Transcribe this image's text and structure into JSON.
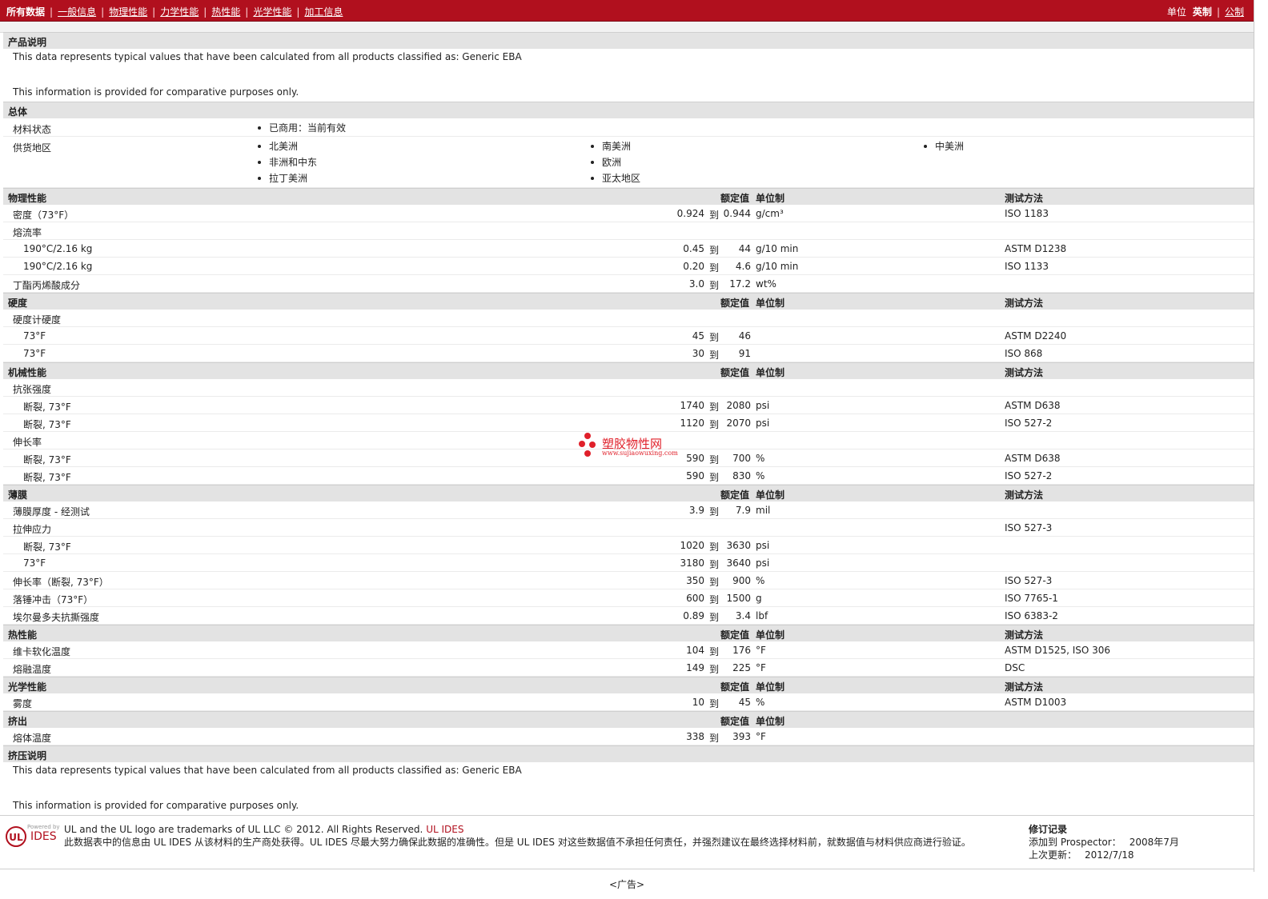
{
  "nav": {
    "tabs": [
      "所有数据",
      "一般信息",
      "物理性能",
      "力学性能",
      "热性能",
      "光学性能",
      "加工信息"
    ],
    "units_label": "单位",
    "unit_selected": "英制",
    "unit_alt": "公制"
  },
  "header_labels": {
    "nominal": "额定值",
    "unit": "单位制",
    "test": "测试方法"
  },
  "product": {
    "title": "产品说明",
    "line1": "This data represents typical values that have been calculated from all products classified as: Generic EBA",
    "line2": "This information is provided for comparative purposes only."
  },
  "general": {
    "title": "总体",
    "status_label": "材料状态",
    "status_value": "已商用：当前有效",
    "supply_label": "供货地区",
    "regions_col1": [
      "北美洲",
      "非洲和中东",
      "拉丁美洲"
    ],
    "regions_col2": [
      "南美洲",
      "欧洲",
      "亚太地区"
    ],
    "regions_col3": [
      "中美洲"
    ]
  },
  "physical": {
    "title": "物理性能",
    "rows": [
      {
        "label": "密度（73°F）",
        "v1": "0.924",
        "to": "到",
        "v2": "0.944",
        "unit": "g/cm³",
        "test": "ISO 1183",
        "sub": false
      },
      {
        "label": "熔流率",
        "v1": "",
        "to": "",
        "v2": "",
        "unit": "",
        "test": "",
        "sub": false
      },
      {
        "label": "190°C/2.16 kg",
        "v1": "0.45",
        "to": "到",
        "v2": "44",
        "unit": "g/10 min",
        "test": "ASTM D1238",
        "sub": true
      },
      {
        "label": "190°C/2.16 kg",
        "v1": "0.20",
        "to": "到",
        "v2": "4.6",
        "unit": "g/10 min",
        "test": "ISO 1133",
        "sub": true
      },
      {
        "label": "丁酯丙烯酸成分",
        "v1": "3.0",
        "to": "到",
        "v2": "17.2",
        "unit": "wt%",
        "test": "",
        "sub": false
      }
    ]
  },
  "hardness": {
    "title": "硬度",
    "rows": [
      {
        "label": "硬度计硬度",
        "v1": "",
        "to": "",
        "v2": "",
        "unit": "",
        "test": "",
        "sub": false
      },
      {
        "label": "73°F",
        "v1": "45",
        "to": "到",
        "v2": "46",
        "unit": "",
        "test": "ASTM D2240",
        "sub": true
      },
      {
        "label": "73°F",
        "v1": "30",
        "to": "到",
        "v2": "91",
        "unit": "",
        "test": "ISO 868",
        "sub": true
      }
    ]
  },
  "mechanical": {
    "title": "机械性能",
    "rows": [
      {
        "label": "抗张强度",
        "v1": "",
        "to": "",
        "v2": "",
        "unit": "",
        "test": "",
        "sub": false
      },
      {
        "label": "断裂, 73°F",
        "v1": "1740",
        "to": "到",
        "v2": "2080",
        "unit": "psi",
        "test": "ASTM D638",
        "sub": true
      },
      {
        "label": "断裂, 73°F",
        "v1": "1120",
        "to": "到",
        "v2": "2070",
        "unit": "psi",
        "test": "ISO 527-2",
        "sub": true
      },
      {
        "label": "伸长率",
        "v1": "",
        "to": "",
        "v2": "",
        "unit": "",
        "test": "",
        "sub": false
      },
      {
        "label": "断裂, 73°F",
        "v1": "590",
        "to": "到",
        "v2": "700",
        "unit": "%",
        "test": "ASTM D638",
        "sub": true
      },
      {
        "label": "断裂, 73°F",
        "v1": "590",
        "to": "到",
        "v2": "830",
        "unit": "%",
        "test": "ISO 527-2",
        "sub": true
      }
    ]
  },
  "film": {
    "title": "薄膜",
    "rows": [
      {
        "label": "薄膜厚度 - 经测试",
        "v1": "3.9",
        "to": "到",
        "v2": "7.9",
        "unit": "mil",
        "test": "",
        "sub": false
      },
      {
        "label": "拉伸应力",
        "v1": "",
        "to": "",
        "v2": "",
        "unit": "",
        "test": "ISO 527-3",
        "sub": false
      },
      {
        "label": "断裂, 73°F",
        "v1": "1020",
        "to": "到",
        "v2": "3630",
        "unit": "psi",
        "test": "",
        "sub": true
      },
      {
        "label": "73°F",
        "v1": "3180",
        "to": "到",
        "v2": "3640",
        "unit": "psi",
        "test": "",
        "sub": true
      },
      {
        "label": "伸长率（断裂, 73°F）",
        "v1": "350",
        "to": "到",
        "v2": "900",
        "unit": "%",
        "test": "ISO 527-3",
        "sub": false
      },
      {
        "label": "落锤冲击（73°F）",
        "v1": "600",
        "to": "到",
        "v2": "1500",
        "unit": "g",
        "test": "ISO 7765-1",
        "sub": false
      },
      {
        "label": "埃尔曼多夫抗撕强度",
        "v1": "0.89",
        "to": "到",
        "v2": "3.4",
        "unit": "lbf",
        "test": "ISO 6383-2",
        "sub": false
      }
    ]
  },
  "thermal": {
    "title": "热性能",
    "rows": [
      {
        "label": "维卡软化温度",
        "v1": "104",
        "to": "到",
        "v2": "176",
        "unit": "°F",
        "test": "ASTM D1525, ISO 306",
        "sub": false
      },
      {
        "label": "熔融温度",
        "v1": "149",
        "to": "到",
        "v2": "225",
        "unit": "°F",
        "test": "DSC",
        "sub": false
      }
    ]
  },
  "optical": {
    "title": "光学性能",
    "rows": [
      {
        "label": "雾度",
        "v1": "10",
        "to": "到",
        "v2": "45",
        "unit": "%",
        "test": "ASTM D1003",
        "sub": false
      }
    ]
  },
  "extrusion": {
    "title": "挤出",
    "rows": [
      {
        "label": "熔体温度",
        "v1": "338",
        "to": "到",
        "v2": "393",
        "unit": "°F",
        "test": "",
        "sub": false
      }
    ]
  },
  "extrusion_note": {
    "title": "挤压说明",
    "line1": "This data represents typical values that have been calculated from all products classified as: Generic EBA",
    "line2": "This information is provided for comparative purposes only."
  },
  "watermark": {
    "cn": "塑胶物性网",
    "url": "www.sujiaowuxing.com"
  },
  "footer": {
    "powered": "Powered by",
    "brand": "IDES",
    "trademark": "UL and the UL logo are trademarks of UL LLC © 2012. All Rights Reserved.",
    "trademark_link": "UL IDES",
    "disclaimer": "此数据表中的信息由 UL IDES 从该材料的生产商处获得。UL IDES 尽最大努力确保此数据的准确性。但是 UL IDES 对这些数据值不承担任何责任，并强烈建议在最终选择材料前，就数据值与材料供应商进行验证。",
    "revision_title": "修订记录",
    "added_label": "添加到 Prospector：",
    "added_value": "2008年7月",
    "updated_label": "上次更新：",
    "updated_value": "2012/7/18"
  },
  "ad_label": "<广告>"
}
